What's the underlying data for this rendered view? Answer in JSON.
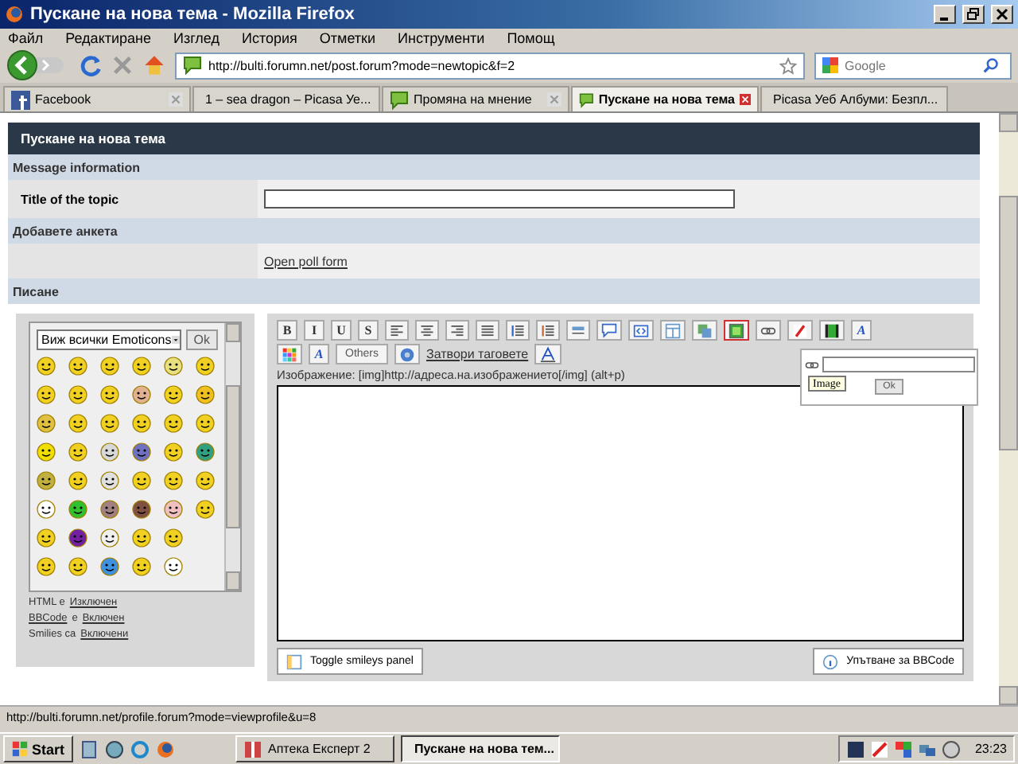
{
  "window": {
    "title": "Пускане на нова тема - Mozilla Firefox"
  },
  "menu": [
    "Файл",
    "Редактиране",
    "Изглед",
    "История",
    "Отметки",
    "Инструменти",
    "Помощ"
  ],
  "address_bar": {
    "url": "http://bulti.forumn.net/post.forum?mode=newtopic&f=2"
  },
  "search": {
    "placeholder": "Google"
  },
  "tabs": [
    {
      "kind": "facebook",
      "label": "Facebook",
      "selected": false
    },
    {
      "kind": "picasa",
      "label": "1 – sea dragon – Picasa Уе...",
      "selected": false
    },
    {
      "kind": "chat",
      "label": "Промяна на мнение",
      "selected": false
    },
    {
      "kind": "chat",
      "label": "Пускане на нова тема",
      "selected": true
    },
    {
      "kind": "google",
      "label": "Picasa Уеб Албуми: Безпл...",
      "selected": false
    }
  ],
  "page": {
    "header": "Пускане на нова тема",
    "sections": [
      {
        "kind": "heading",
        "label": "Message information"
      },
      {
        "kind": "field",
        "label": "Title of the topic"
      },
      {
        "kind": "heading",
        "label": "Добавете анкета"
      },
      {
        "kind": "link",
        "link": "Open poll form"
      },
      {
        "kind": "heading",
        "label": "Писане"
      }
    ]
  },
  "emoticons": {
    "select": "Виж всички Emoticons",
    "ok": "Ok",
    "status": [
      {
        "prefix": "HTML е",
        "link": "Изключен"
      },
      {
        "prefix_link": "BBCode",
        "prefix": "е",
        "link": "Включен"
      },
      {
        "prefix": "Smilies са",
        "link": "Включени"
      }
    ]
  },
  "editor": {
    "toolbar": [
      [
        {
          "kind": "letter",
          "label": "B",
          "selected": false
        },
        {
          "kind": "letter",
          "label": "I",
          "selected": false
        },
        {
          "kind": "letter",
          "label": "U",
          "selected": false
        },
        {
          "kind": "letter",
          "label": "S",
          "selected": false
        },
        {
          "kind": "align-left",
          "selected": false
        },
        {
          "kind": "align-center",
          "selected": false
        },
        {
          "kind": "align-right",
          "selected": false
        },
        {
          "kind": "justify",
          "selected": false
        },
        {
          "kind": "bullets",
          "selected": false
        },
        {
          "kind": "numbers",
          "selected": false
        },
        {
          "kind": "rule",
          "selected": false
        },
        {
          "kind": "quote",
          "selected": false
        },
        {
          "kind": "code",
          "selected": false
        },
        {
          "kind": "table",
          "selected": false
        },
        {
          "kind": "copy",
          "selected": false
        },
        {
          "kind": "picture",
          "selected": true
        },
        {
          "kind": "link",
          "selected": false
        },
        {
          "kind": "flash",
          "selected": false
        },
        {
          "kind": "film",
          "selected": false
        },
        {
          "kind": "letter",
          "label": "A",
          "selected": false
        }
      ],
      [
        {
          "kind": "palette",
          "selected": false
        },
        {
          "kind": "letter",
          "label": "A",
          "selected": false
        },
        {
          "kind": "text",
          "label": "Others",
          "selected": false
        },
        {
          "kind": "help",
          "selected": false
        },
        {
          "kind": "textlink",
          "label": "Затвори таговете",
          "selected": false
        },
        {
          "kind": "fontsize",
          "selected": false
        }
      ]
    ],
    "hint": "Изображение: [img]http://адреса.на.изображението[/img] (alt+p)",
    "popup": {
      "tooltip": "Image",
      "ok": "Ok"
    },
    "toggle_button": "Toggle smileys panel",
    "help_button": "Упътване за BBCode"
  },
  "status_bar": "http://bulti.forumn.net/profile.forum?mode=viewprofile&u=8",
  "taskbar": {
    "start": "Start",
    "tasks": [
      {
        "kind": "app",
        "label": "Аптека Експерт 2",
        "selected": false
      },
      {
        "kind": "firefox",
        "label": "Пускане на нова тем...",
        "selected": true
      }
    ],
    "clock": "23:23"
  }
}
